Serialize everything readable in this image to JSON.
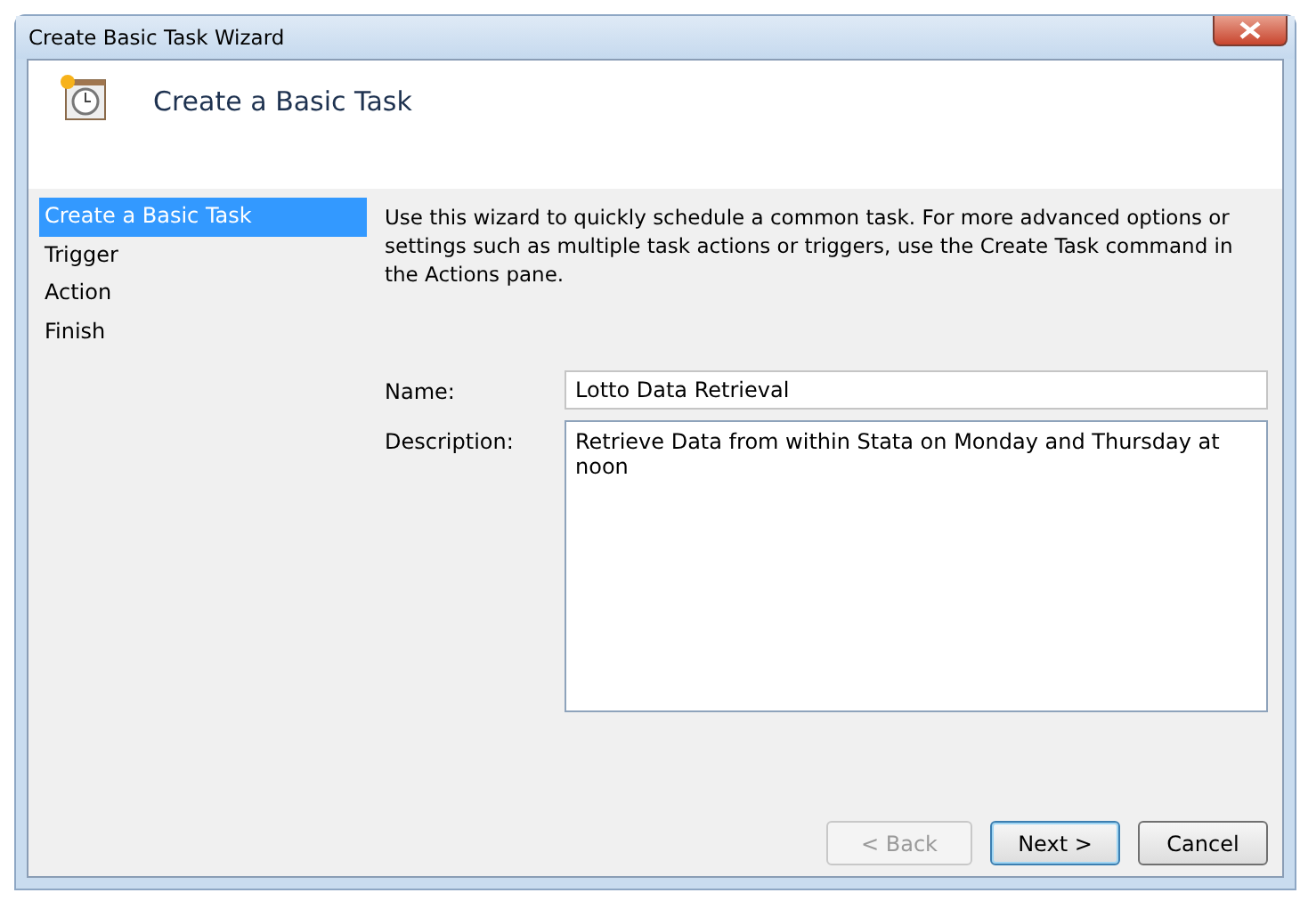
{
  "window": {
    "title": "Create Basic Task Wizard"
  },
  "header": {
    "title": "Create a Basic Task"
  },
  "steps": [
    {
      "label": "Create a Basic Task",
      "selected": true
    },
    {
      "label": "Trigger",
      "selected": false
    },
    {
      "label": "Action",
      "selected": false
    },
    {
      "label": "Finish",
      "selected": false
    }
  ],
  "intro": "Use this wizard to quickly schedule a common task.  For more advanced options or settings such as multiple task actions or triggers, use the Create Task command in the Actions pane.",
  "fields": [
    {
      "label": "Name:",
      "kind": "line",
      "value": "Lotto Data Retrieval"
    },
    {
      "label": "Description:",
      "kind": "multiline",
      "value": "Retrieve Data from within Stata on Monday and Thursday at noon"
    }
  ],
  "buttons": [
    {
      "label": "< Back",
      "disabled": true,
      "default": false
    },
    {
      "label": "Next >",
      "disabled": false,
      "default": true
    },
    {
      "label": "Cancel",
      "disabled": false,
      "default": false
    }
  ]
}
